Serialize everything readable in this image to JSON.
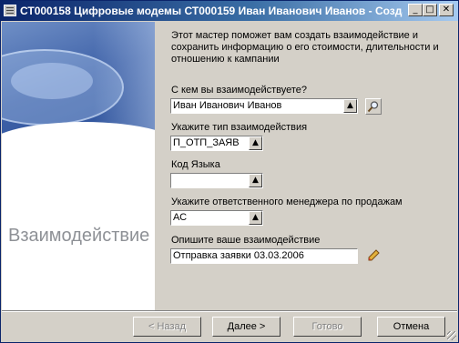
{
  "window": {
    "title": "СТ000158 Цифровые модемы СТ000159 Иван Иванович Иванов - Созда...",
    "minimize_glyph": "_",
    "maximize_glyph": "□",
    "close_glyph": "✕"
  },
  "sidebar": {
    "title": "Взаимодействие"
  },
  "intro": "Этот мастер поможет вам создать взаимодействие и сохранить информацию о его стоимости, длительности и отношению к кампании",
  "form": {
    "contact": {
      "label": "С кем вы взаимодействуете?",
      "value": "Иван Иванович Иванов"
    },
    "type": {
      "label": "Укажите тип взаимодействия",
      "value": "П_ОТП_ЗАЯВ"
    },
    "language": {
      "label": "Код Языка",
      "value": ""
    },
    "manager": {
      "label": "Укажите ответственного менеджера по продажам",
      "value": "АС"
    },
    "description": {
      "label": "Опишите ваше взаимодействие",
      "value": "Отправка заявки 03.03.2006"
    }
  },
  "buttons": {
    "back": "< Назад",
    "next": "Далее >",
    "finish": "Готово",
    "cancel": "Отмена"
  },
  "icons": {
    "dropdown": "arrow-up-icon",
    "lookup": "magnifier-icon",
    "edit": "pencil-icon"
  }
}
